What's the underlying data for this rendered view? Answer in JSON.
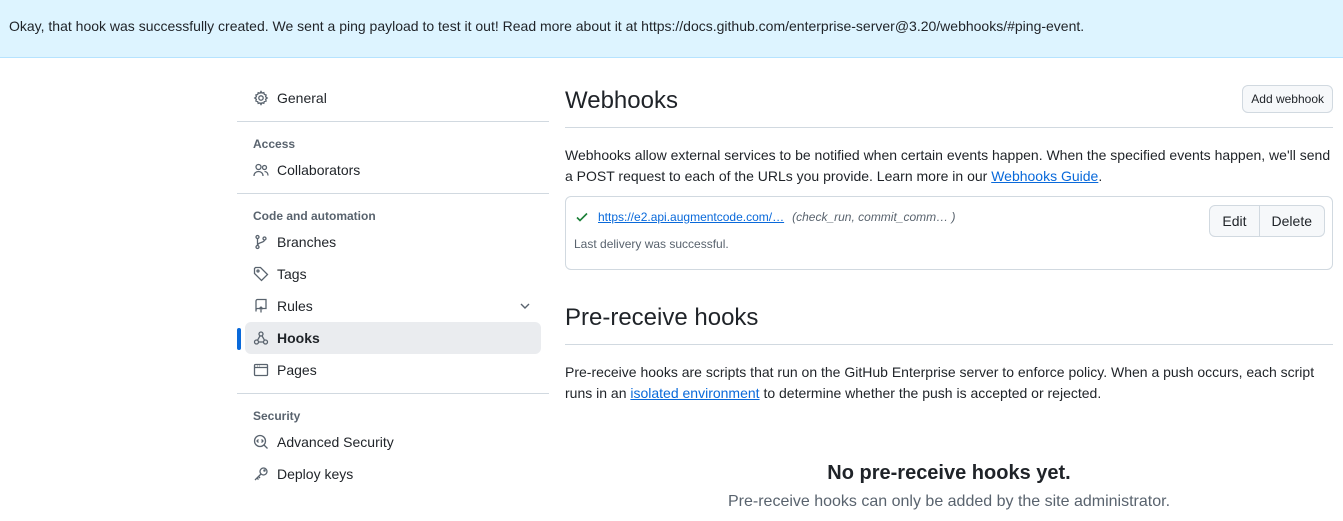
{
  "flash": {
    "message": "Okay, that hook was successfully created. We sent a ping payload to test it out! Read more about it at https://docs.github.com/enterprise-server@3.20/webhooks/#ping-event."
  },
  "sidebar": {
    "general": {
      "label": "General",
      "icon": "gear-icon"
    },
    "access": {
      "title": "Access",
      "items": [
        {
          "label": "Collaborators",
          "icon": "people-icon"
        }
      ]
    },
    "code_automation": {
      "title": "Code and automation",
      "items": [
        {
          "label": "Branches",
          "icon": "git-branch-icon"
        },
        {
          "label": "Tags",
          "icon": "tag-icon"
        },
        {
          "label": "Rules",
          "icon": "repo-push-icon",
          "expandable": true
        },
        {
          "label": "Hooks",
          "icon": "webhook-icon",
          "active": true
        },
        {
          "label": "Pages",
          "icon": "browser-icon"
        }
      ]
    },
    "security": {
      "title": "Security",
      "items": [
        {
          "label": "Advanced Security",
          "icon": "codescan-icon"
        },
        {
          "label": "Deploy keys",
          "icon": "key-icon"
        }
      ]
    }
  },
  "webhooks": {
    "title": "Webhooks",
    "add_button": "Add webhook",
    "description_before": "Webhooks allow external services to be notified when certain events happen. When the specified events happen, we'll send a POST request to each of the URLs you provide. Learn more in our ",
    "guide_link": "Webhooks Guide",
    "description_after": ".",
    "hook": {
      "url": "https://e2.api.augmentcode.com/…",
      "events": "(check_run, commit_comm… )",
      "status": "Last delivery was successful.",
      "edit_label": "Edit",
      "delete_label": "Delete"
    }
  },
  "prereceive": {
    "title": "Pre-receive hooks",
    "description_before": "Pre-receive hooks are scripts that run on the GitHub Enterprise server to enforce policy. When a push occurs, each script runs in an ",
    "link": "isolated environment",
    "description_after": " to determine whether the push is accepted or rejected.",
    "empty_title": "No pre-receive hooks yet.",
    "empty_text": "Pre-receive hooks can only be added by the site administrator."
  },
  "colors": {
    "accent": "#0969da",
    "success": "#1a7f37",
    "flash_bg": "#ddf4ff"
  }
}
